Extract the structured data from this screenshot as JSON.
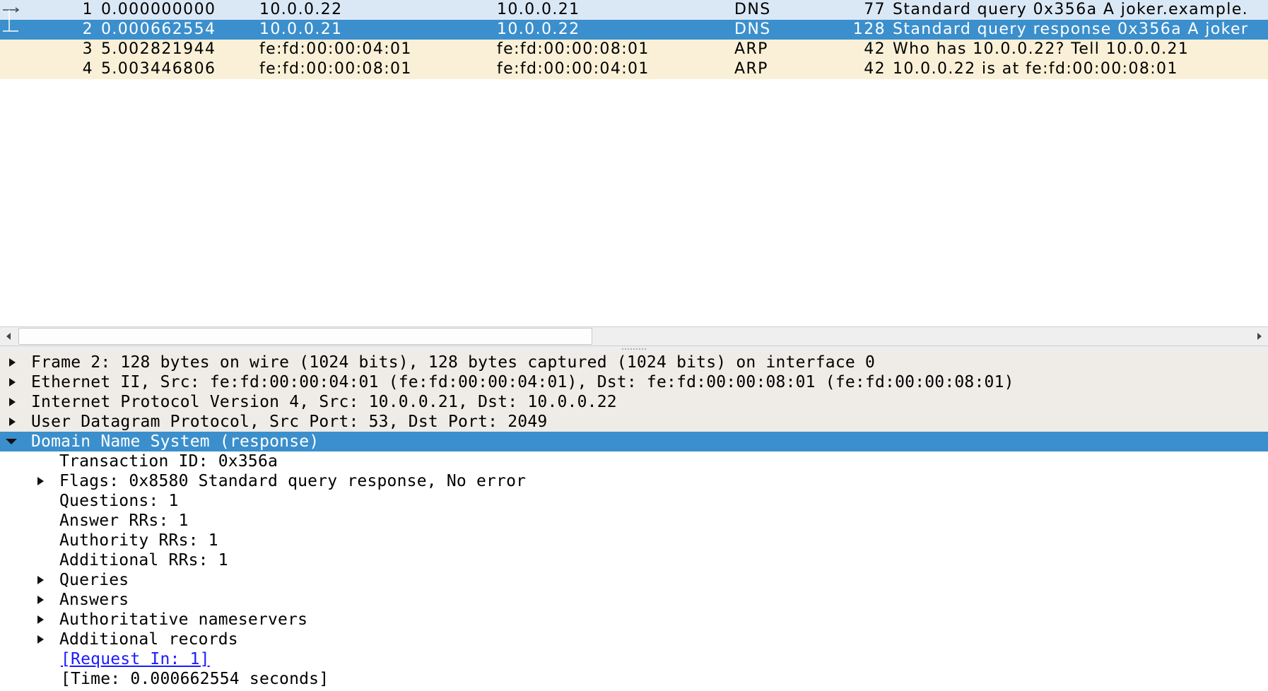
{
  "packets": [
    {
      "no": "1",
      "time": "0.000000000",
      "src": "10.0.0.22",
      "dst": "10.0.0.21",
      "proto": "DNS",
      "len": "77",
      "info": "Standard query 0x356a A joker.example.",
      "bg": "#dae8f6",
      "fg": "#000000"
    },
    {
      "no": "2",
      "time": "0.000662554",
      "src": "10.0.0.21",
      "dst": "10.0.0.22",
      "proto": "DNS",
      "len": "128",
      "info": "Standard query response 0x356a A joker",
      "bg": "#3b8fcc",
      "fg": "#ffffff"
    },
    {
      "no": "3",
      "time": "5.002821944",
      "src": "fe:fd:00:00:04:01",
      "dst": "fe:fd:00:00:08:01",
      "proto": "ARP",
      "len": "42",
      "info": "Who has 10.0.0.22? Tell 10.0.0.21",
      "bg": "#faf0d7",
      "fg": "#000000"
    },
    {
      "no": "4",
      "time": "5.003446806",
      "src": "fe:fd:00:00:08:01",
      "dst": "fe:fd:00:00:04:01",
      "proto": "ARP",
      "len": "42",
      "info": "10.0.0.22 is at fe:fd:00:00:08:01",
      "bg": "#faf0d7",
      "fg": "#000000"
    }
  ],
  "details": {
    "frame": "Frame 2: 128 bytes on wire (1024 bits), 128 bytes captured (1024 bits) on interface 0",
    "ethernet": "Ethernet II, Src: fe:fd:00:00:04:01 (fe:fd:00:00:04:01), Dst: fe:fd:00:00:08:01 (fe:fd:00:00:08:01)",
    "ip": "Internet Protocol Version 4, Src: 10.0.0.21, Dst: 10.0.0.22",
    "udp": "User Datagram Protocol, Src Port: 53, Dst Port: 2049",
    "dns": "Domain Name System (response)",
    "transaction_id": "Transaction ID: 0x356a",
    "flags": "Flags: 0x8580 Standard query response, No error",
    "questions": "Questions: 1",
    "answer_rrs": "Answer RRs: 1",
    "authority_rrs": "Authority RRs: 1",
    "additional_rrs": "Additional RRs: 1",
    "queries": "Queries",
    "answers": "Answers",
    "authoritative": "Authoritative nameservers",
    "additional_records": "Additional records",
    "request_in": "[Request In: 1]",
    "time": "[Time: 0.000662554 seconds]"
  },
  "colors": {
    "selected": "#3b8fcc",
    "protocol_header_bg": "#efebe7",
    "link": "#1a1aff"
  },
  "icons": {
    "related_packet": "request-response-bracket-icon",
    "collapsed": "triangle-right-icon",
    "expanded": "triangle-down-icon",
    "scroll_left": "arrow-left-icon",
    "scroll_right": "arrow-right-icon"
  }
}
